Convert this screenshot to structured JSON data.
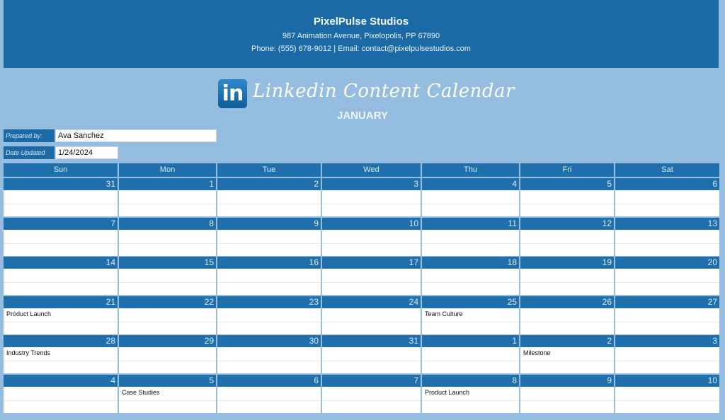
{
  "header": {
    "company": "PixelPulse Studios",
    "address": "987 Animation Avenue, Pixelopolis, PP 67890",
    "contact": "Phone: (555) 678-9012 | Email: contact@pixelpulsestudios.com"
  },
  "title": {
    "logo_text": "in",
    "logo_icon": "linkedin-icon",
    "text": "Linkedin Content Calendar",
    "month": "JANUARY"
  },
  "meta": {
    "prepared_by_label": "Prepared by:",
    "prepared_by_value": "Ava Sanchez",
    "date_updated_label": "Date Updated",
    "date_updated_value": "1/24/2024"
  },
  "colors": {
    "primary": "#1b6aa6",
    "background": "#94bde0"
  },
  "calendar": {
    "days": [
      "Sun",
      "Mon",
      "Tue",
      "Wed",
      "Thu",
      "Fri",
      "Sat"
    ],
    "weeks": [
      [
        {
          "d": "31",
          "e": ""
        },
        {
          "d": "1",
          "e": ""
        },
        {
          "d": "2",
          "e": ""
        },
        {
          "d": "3",
          "e": ""
        },
        {
          "d": "4",
          "e": ""
        },
        {
          "d": "5",
          "e": ""
        },
        {
          "d": "6",
          "e": ""
        }
      ],
      [
        {
          "d": "7",
          "e": ""
        },
        {
          "d": "8",
          "e": ""
        },
        {
          "d": "9",
          "e": ""
        },
        {
          "d": "10",
          "e": ""
        },
        {
          "d": "11",
          "e": ""
        },
        {
          "d": "12",
          "e": ""
        },
        {
          "d": "13",
          "e": ""
        }
      ],
      [
        {
          "d": "14",
          "e": ""
        },
        {
          "d": "15",
          "e": ""
        },
        {
          "d": "16",
          "e": ""
        },
        {
          "d": "17",
          "e": ""
        },
        {
          "d": "18",
          "e": ""
        },
        {
          "d": "19",
          "e": ""
        },
        {
          "d": "20",
          "e": ""
        }
      ],
      [
        {
          "d": "21",
          "e": "Product Launch"
        },
        {
          "d": "22",
          "e": ""
        },
        {
          "d": "23",
          "e": ""
        },
        {
          "d": "24",
          "e": ""
        },
        {
          "d": "25",
          "e": "Team Culture"
        },
        {
          "d": "26",
          "e": ""
        },
        {
          "d": "27",
          "e": ""
        }
      ],
      [
        {
          "d": "28",
          "e": "Industry Trends"
        },
        {
          "d": "29",
          "e": ""
        },
        {
          "d": "30",
          "e": ""
        },
        {
          "d": "31",
          "e": ""
        },
        {
          "d": "1",
          "e": ""
        },
        {
          "d": "2",
          "e": "Milestone"
        },
        {
          "d": "3",
          "e": ""
        }
      ],
      [
        {
          "d": "4",
          "e": ""
        },
        {
          "d": "5",
          "e": "Case Studies"
        },
        {
          "d": "6",
          "e": ""
        },
        {
          "d": "7",
          "e": ""
        },
        {
          "d": "8",
          "e": "Product Launch"
        },
        {
          "d": "9",
          "e": ""
        },
        {
          "d": "10",
          "e": ""
        }
      ]
    ]
  }
}
